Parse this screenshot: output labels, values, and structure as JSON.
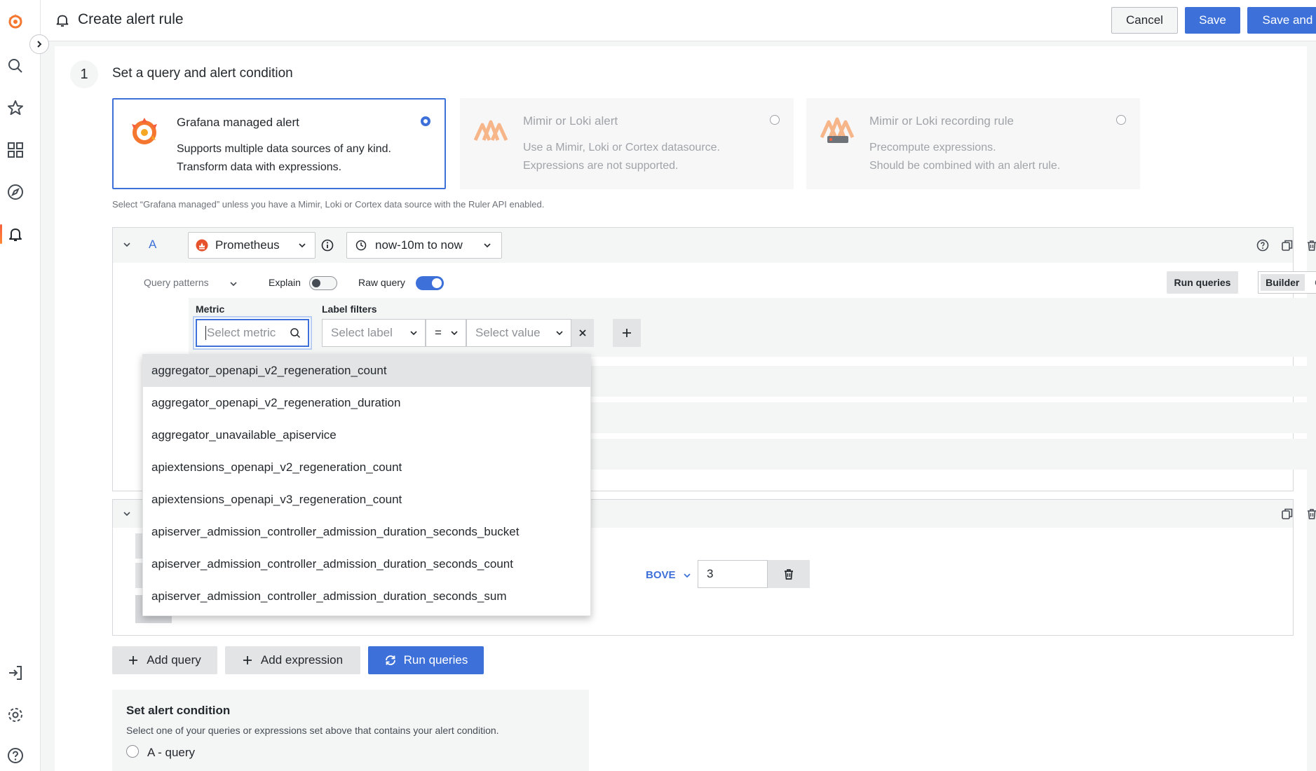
{
  "header": {
    "title": "Create alert rule",
    "cancel_label": "Cancel",
    "save_label": "Save",
    "save_exit_label": "Save and exit"
  },
  "step": {
    "number": "1",
    "title": "Set a query and alert condition"
  },
  "rule_types": [
    {
      "title": "Grafana managed alert",
      "line1": "Supports multiple data sources of any kind.",
      "line2": "Transform data with expressions.",
      "selected": true
    },
    {
      "title": "Mimir or Loki alert",
      "line1": "Use a Mimir, Loki or Cortex datasource.",
      "line2": "Expressions are not supported.",
      "selected": false
    },
    {
      "title": "Mimir or Loki recording rule",
      "line1": "Precompute expressions.",
      "line2": "Should be combined with an alert rule.",
      "selected": false
    }
  ],
  "hint": "Select “Grafana managed” unless you have a Mimir, Loki or Cortex data source with the Ruler API enabled.",
  "query": {
    "ref_id": "A",
    "datasource": "Prometheus",
    "time_range": "now-10m to now",
    "query_patterns_label": "Query patterns",
    "explain_label": "Explain",
    "raw_query_label": "Raw query",
    "explain_on": false,
    "raw_query_on": true,
    "run_queries_label": "Run queries",
    "mode_builder": "Builder",
    "mode_code": "Code",
    "metric_label": "Metric",
    "metric_placeholder": "Select metric",
    "label_filters_label": "Label filters",
    "label_placeholder": "Select label",
    "operator": "=",
    "value_placeholder": "Select value"
  },
  "metric_options": [
    "aggregator_openapi_v2_regeneration_count",
    "aggregator_openapi_v2_regeneration_duration",
    "aggregator_unavailable_apiservice",
    "apiextensions_openapi_v2_regeneration_count",
    "apiextensions_openapi_v3_regeneration_count",
    "apiserver_admission_controller_admission_duration_seconds_bucket",
    "apiserver_admission_controller_admission_duration_seconds_count",
    "apiserver_admission_controller_admission_duration_seconds_sum"
  ],
  "expression": {
    "operator_partial": "BOVE",
    "threshold_value": "3"
  },
  "actions": {
    "add_query": "Add query",
    "add_expression": "Add expression",
    "run_queries": "Run queries"
  },
  "condition": {
    "title": "Set alert condition",
    "description": "Select one of your queries or expressions set above that contains your alert condition.",
    "option_a": "A - query"
  },
  "colors": {
    "primary": "#3d71d9",
    "grafana_orange": "#f55f3e"
  }
}
